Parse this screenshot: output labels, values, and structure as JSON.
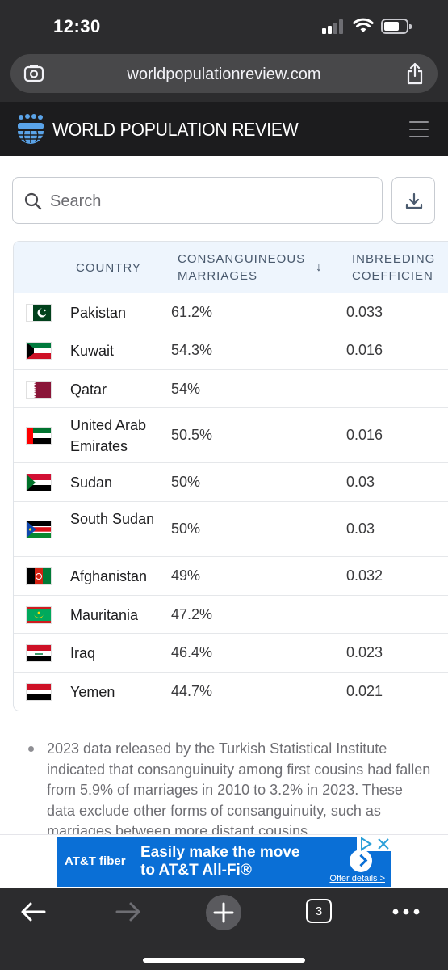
{
  "status": {
    "time": "12:30"
  },
  "browser": {
    "url": "worldpopulationreview.com",
    "tab_count": "3"
  },
  "site": {
    "brand": "WORLD POPULATION REVIEW"
  },
  "search": {
    "placeholder": "Search"
  },
  "table": {
    "headers": {
      "country": "COUNTRY",
      "cons_line1": "CONSANGUINEOUS",
      "cons_line2": "MARRIAGES",
      "sort_arrow": "↓",
      "inb_line1": "INBREEDING",
      "inb_line2": "COEFFICIEN"
    },
    "rows": [
      {
        "country": "Pakistan",
        "consanguineous": "61.2%",
        "inbreeding": "0.033",
        "flag": "pakistan-flag"
      },
      {
        "country": "Kuwait",
        "consanguineous": "54.3%",
        "inbreeding": "0.016",
        "flag": "kuwait-flag"
      },
      {
        "country": "Qatar",
        "consanguineous": "54%",
        "inbreeding": "",
        "flag": "qatar-flag"
      },
      {
        "country": "United Arab Emirates",
        "consanguineous": "50.5%",
        "inbreeding": "0.016",
        "flag": "uae-flag"
      },
      {
        "country": "Sudan",
        "consanguineous": "50%",
        "inbreeding": "0.03",
        "flag": "sudan-flag"
      },
      {
        "country": "South Sudan",
        "consanguineous": "50%",
        "inbreeding": "0.03",
        "flag": "south-sudan-flag"
      },
      {
        "country": "Afghanistan",
        "consanguineous": "49%",
        "inbreeding": "0.032",
        "flag": "afghanistan-flag"
      },
      {
        "country": "Mauritania",
        "consanguineous": "47.2%",
        "inbreeding": "",
        "flag": "mauritania-flag"
      },
      {
        "country": "Iraq",
        "consanguineous": "46.4%",
        "inbreeding": "0.023",
        "flag": "iraq-flag"
      },
      {
        "country": "Yemen",
        "consanguineous": "44.7%",
        "inbreeding": "0.021",
        "flag": "yemen-flag"
      }
    ]
  },
  "note": {
    "text": "2023 data released by the Turkish Statistical Institute indicated that consanguinuity among first cousins had fallen from 5.9% of marriages in 2010 to 3.2% in 2023. These data exclude other forms of consanguinuity, such as marriages between more distant cousins."
  },
  "ad": {
    "brand": "AT&T fiber",
    "headline_line1": "Easily make the move",
    "headline_line2": "to AT&T All-Fi®",
    "offer": "Offer details >"
  },
  "colors": {
    "accent": "#0a6fd6",
    "header_bg": "#1c1c1e",
    "table_header_bg": "#eef5fd"
  }
}
